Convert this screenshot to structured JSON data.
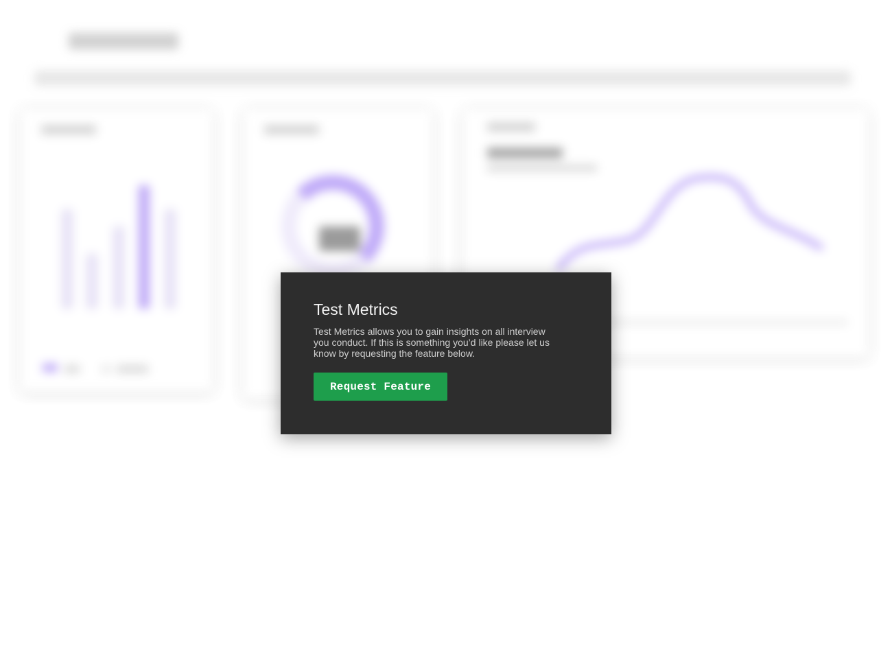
{
  "colors": {
    "modal_background": "#2d2d2d",
    "button_green": "#1e9e4c",
    "accent_purple": "#b49bf7"
  },
  "modal": {
    "title": "Test Metrics",
    "body": "Test Metrics allows you to gain insights on all interview you conduct. If this is something you’d like please let us know by requesting the feature below.",
    "button_label": "Request Feature"
  }
}
